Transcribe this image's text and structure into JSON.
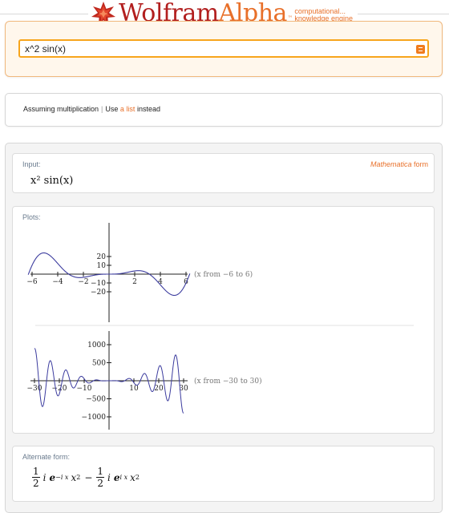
{
  "header": {
    "brand_part1": "Wolfram",
    "brand_part2": "Alpha",
    "trademark": "™",
    "tagline_line1": "computational...",
    "tagline_line2": "knowledge engine"
  },
  "search": {
    "query": "x^2 sin(x)"
  },
  "assumption": {
    "prefix": "Assuming multiplication",
    "separator": "|",
    "use_text": "Use",
    "link_text": "a list",
    "suffix": "instead"
  },
  "pods": {
    "input": {
      "title": "Input:",
      "aside_italic": "Mathematica",
      "aside_rest": "form",
      "expression": "x² sin(x)"
    },
    "plots": {
      "title": "Plots:",
      "plot1": {
        "range_label": "(x from −6 to 6)",
        "x_ticks": [
          "−6",
          "−4",
          "−2",
          "2",
          "4",
          "6"
        ],
        "y_ticks": [
          "20",
          "10",
          "−10",
          "−20"
        ]
      },
      "plot2": {
        "range_label": "(x from −30 to 30)",
        "x_ticks": [
          "−30",
          "−20",
          "−10",
          "10",
          "20",
          "30"
        ],
        "y_ticks": [
          "1000",
          "500",
          "−500",
          "−1000"
        ]
      }
    },
    "alternate": {
      "title": "Alternate form:",
      "frac_num": "1",
      "frac_den": "2",
      "i": "i",
      "e": "e",
      "exp1": "−i x",
      "exp2": "i x",
      "minus": "−",
      "x": "x",
      "sq": "2"
    }
  },
  "colors": {
    "accent_orange": "#e8702a",
    "brand_red": "#b21f1f",
    "plot_line": "#3b3b9e",
    "pod_title": "#6a7b8e"
  }
}
